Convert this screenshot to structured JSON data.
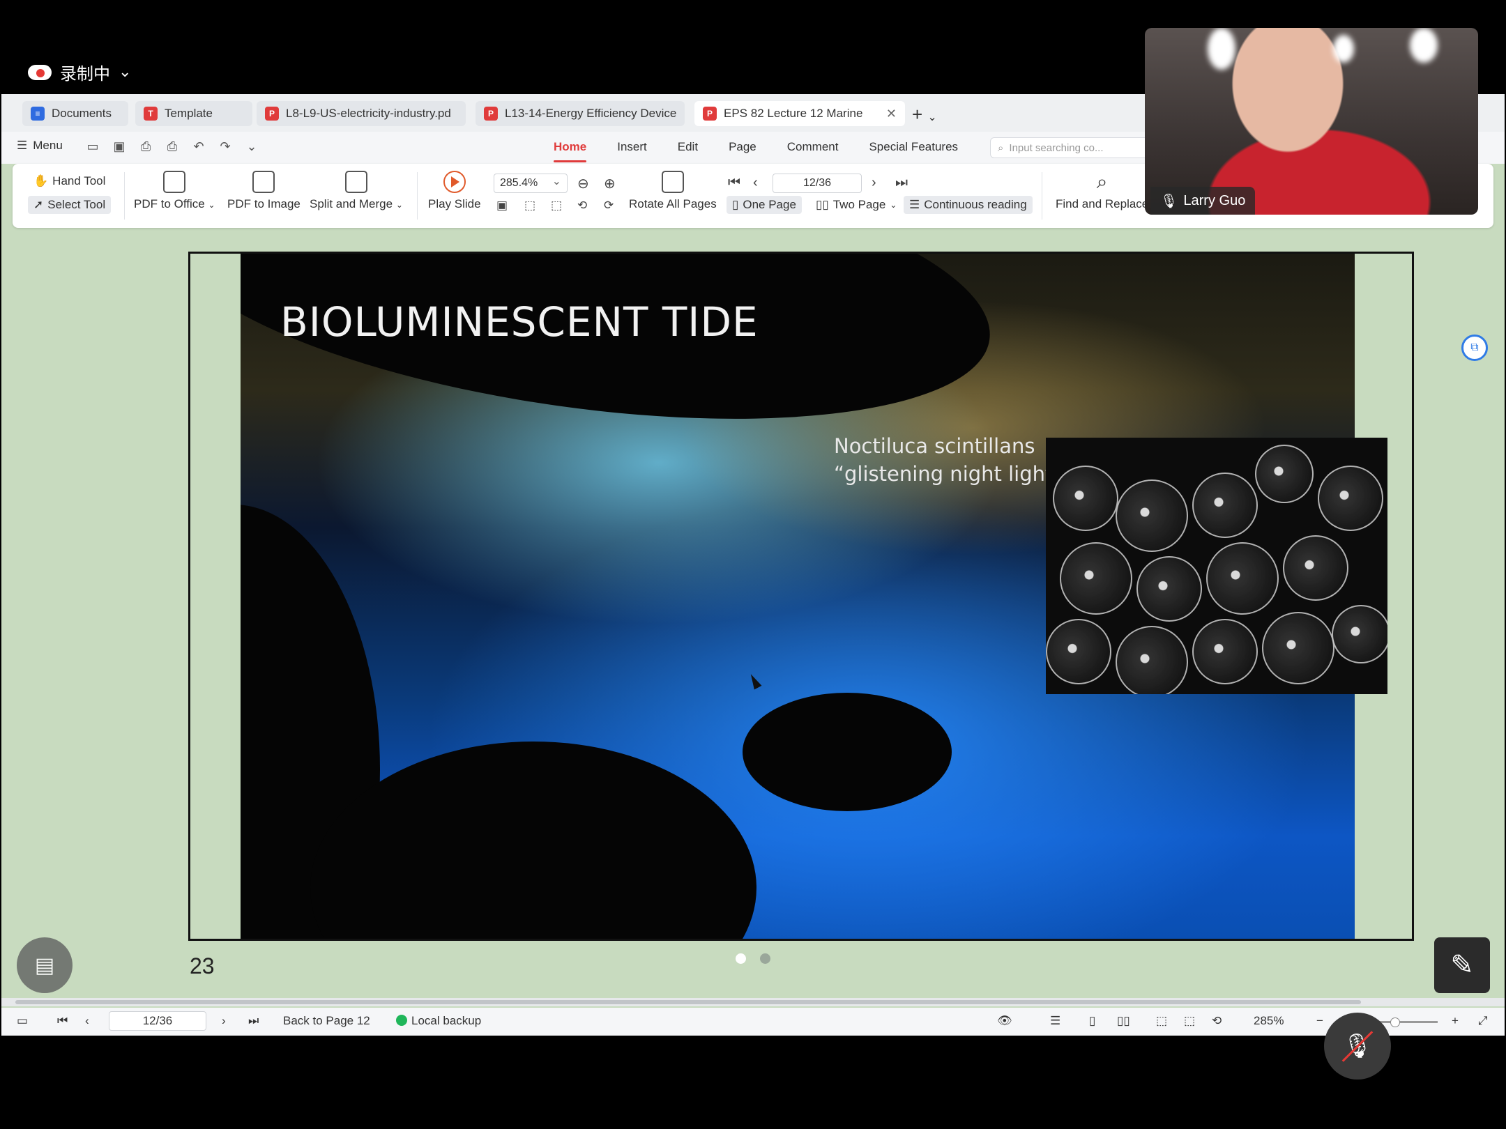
{
  "recording": {
    "label": "录制中"
  },
  "tabs": [
    {
      "label": "Documents",
      "icon": "docs-icon"
    },
    {
      "label": "Template",
      "icon": "template-icon"
    },
    {
      "label": "L8-L9-US-electricity-industry.pd",
      "icon": "pdf-icon"
    },
    {
      "label": "L13-14-Energy Efficiency Device",
      "icon": "pdf-icon"
    },
    {
      "label": "EPS 82 Lecture 12 Marine",
      "icon": "pdf-icon"
    }
  ],
  "menu": {
    "label": "Menu"
  },
  "nav_tabs": [
    "Home",
    "Insert",
    "Edit",
    "Page",
    "Comment",
    "Special Features"
  ],
  "search": {
    "placeholder": "Input searching co..."
  },
  "ribbon": {
    "hand_tool": "Hand Tool",
    "select_tool": "Select Tool",
    "pdf_to_office": "PDF to Office",
    "pdf_to_image": "PDF to Image",
    "split_merge": "Split and Merge",
    "play_slide": "Play Slide",
    "zoom": "285.4%",
    "rotate_all": "Rotate All Pages",
    "page_box": "12/36",
    "one_page": "One Page",
    "two_page": "Two Page",
    "continuous": "Continuous reading",
    "find_replace": "Find and Replace"
  },
  "slide": {
    "title": "BIOLUMINESCENT TIDE",
    "caption_line1": "Noctiluca scintillans",
    "caption_line2": "“glistening night light”",
    "page_number": "23",
    "carousel_active_index": 0
  },
  "status": {
    "page_box": "12/36",
    "back": "Back to Page 12",
    "backup": "Local backup",
    "zoom": "285%"
  },
  "video": {
    "participant": "Larry Guo"
  }
}
